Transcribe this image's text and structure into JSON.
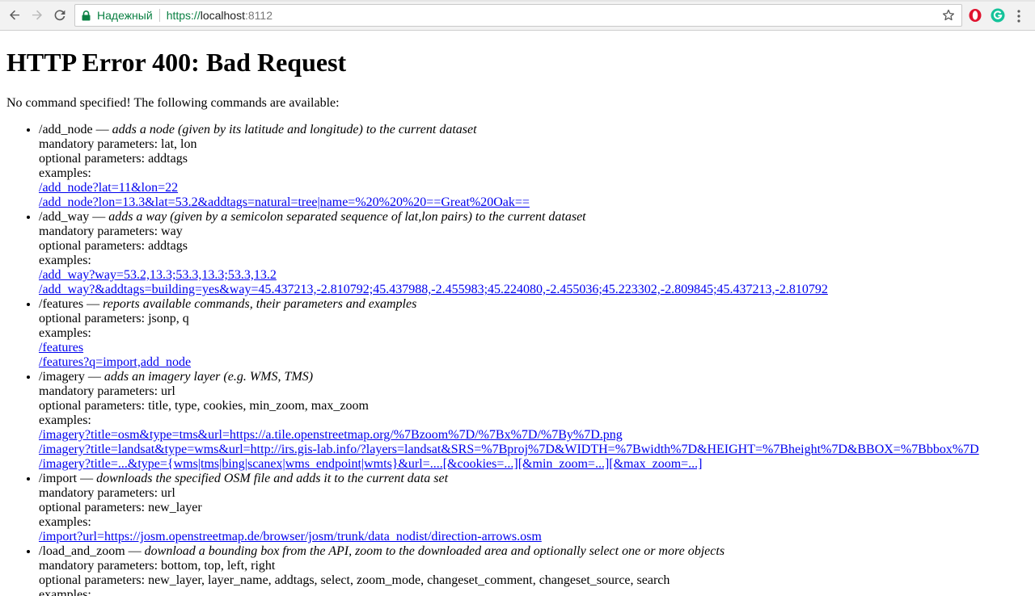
{
  "browser": {
    "secure_label": "Надежный",
    "url_scheme": "https://",
    "url_host": "localhost",
    "url_port": ":8112"
  },
  "page": {
    "title": "HTTP Error 400: Bad Request",
    "intro": "No command specified! The following commands are available:",
    "commands": [
      {
        "name": "/add_node",
        "dash": " — ",
        "description": "adds a node (given by its latitude and longitude) to the current dataset",
        "mandatory": "mandatory parameters: lat, lon",
        "optional": "optional parameters: addtags",
        "examples_label": "examples:",
        "examples": [
          "/add_node?lat=11&lon=22",
          "/add_node?lon=13.3&lat=53.2&addtags=natural=tree|name=%20%20%20==Great%20Oak=="
        ]
      },
      {
        "name": "/add_way",
        "dash": " — ",
        "description": "adds a way (given by a semicolon separated sequence of lat,lon pairs) to the current dataset",
        "mandatory": "mandatory parameters: way",
        "optional": "optional parameters: addtags",
        "examples_label": "examples:",
        "examples": [
          "/add_way?way=53.2,13.3;53.3,13.3;53.3,13.2",
          "/add_way?&addtags=building=yes&way=45.437213,-2.810792;45.437988,-2.455983;45.224080,-2.455036;45.223302,-2.809845;45.437213,-2.810792"
        ]
      },
      {
        "name": "/features",
        "dash": " — ",
        "description": "reports available commands, their parameters and examples",
        "optional": "optional parameters: jsonp, q",
        "examples_label": "examples:",
        "examples": [
          "/features",
          "/features?q=import,add_node"
        ]
      },
      {
        "name": "/imagery",
        "dash": " — ",
        "description": "adds an imagery layer (e.g. WMS, TMS)",
        "mandatory": "mandatory parameters: url",
        "optional": "optional parameters: title, type, cookies, min_zoom, max_zoom",
        "examples_label": "examples:",
        "examples": [
          "/imagery?title=osm&type=tms&url=https://a.tile.openstreetmap.org/%7Bzoom%7D/%7Bx%7D/%7By%7D.png",
          "/imagery?title=landsat&type=wms&url=http://irs.gis-lab.info/?layers=landsat&SRS=%7Bproj%7D&WIDTH=%7Bwidth%7D&HEIGHT=%7Bheight%7D&BBOX=%7Bbbox%7D",
          "/imagery?title=...&type={wms|tms|bing|scanex|wms_endpoint|wmts}&url=....[&cookies=...][&min_zoom=...][&max_zoom=...]"
        ]
      },
      {
        "name": "/import",
        "dash": " — ",
        "description": "downloads the specified OSM file and adds it to the current data set",
        "mandatory": "mandatory parameters: url",
        "optional": "optional parameters: new_layer",
        "examples_label": "examples:",
        "examples": [
          "/import?url=https://josm.openstreetmap.de/browser/josm/trunk/data_nodist/direction-arrows.osm"
        ]
      },
      {
        "name": "/load_and_zoom",
        "dash": " — ",
        "description": "download a bounding box from the API, zoom to the downloaded area and optionally select one or more objects",
        "mandatory": "mandatory parameters: bottom, top, left, right",
        "optional": "optional parameters: new_layer, layer_name, addtags, select, zoom_mode, changeset_comment, changeset_source, search",
        "examples_label": "examples:",
        "examples": []
      }
    ]
  }
}
